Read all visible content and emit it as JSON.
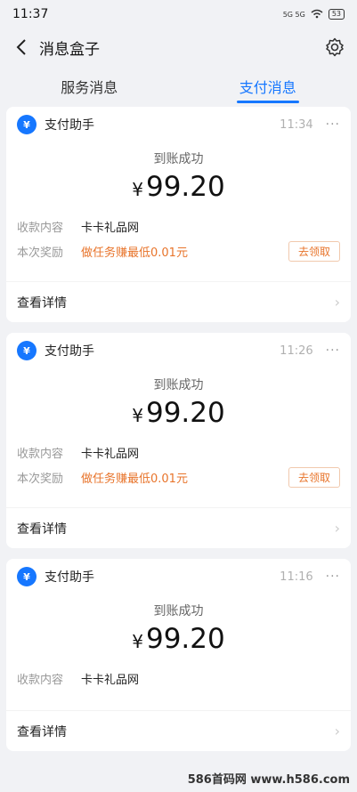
{
  "status_bar": {
    "time": "11:37",
    "icons": "5G 5G",
    "battery": "53"
  },
  "header": {
    "title": "消息盒子"
  },
  "tabs": [
    {
      "label": "服务消息"
    },
    {
      "label": "支付消息"
    }
  ],
  "cards": [
    {
      "sender": "支付助手",
      "time": "11:34",
      "status": "到账成功",
      "currency": "¥",
      "amount": "99.20",
      "rows": [
        {
          "label": "收款内容",
          "value": "卡卡礼品网"
        },
        {
          "label": "本次奖励",
          "value": "做任务赚最低0.01元",
          "button": "去领取"
        }
      ],
      "detail": "查看详情"
    },
    {
      "sender": "支付助手",
      "time": "11:26",
      "status": "到账成功",
      "currency": "¥",
      "amount": "99.20",
      "rows": [
        {
          "label": "收款内容",
          "value": "卡卡礼品网"
        },
        {
          "label": "本次奖励",
          "value": "做任务赚最低0.01元",
          "button": "去领取"
        }
      ],
      "detail": "查看详情"
    },
    {
      "sender": "支付助手",
      "time": "11:16",
      "status": "到账成功",
      "currency": "¥",
      "amount": "99.20",
      "rows": [
        {
          "label": "收款内容",
          "value": "卡卡礼品网"
        }
      ],
      "detail": "查看详情"
    }
  ],
  "watermark": "586首码网 www.h586.com",
  "colors": {
    "accent": "#1677ff",
    "orange": "#e8742b"
  }
}
